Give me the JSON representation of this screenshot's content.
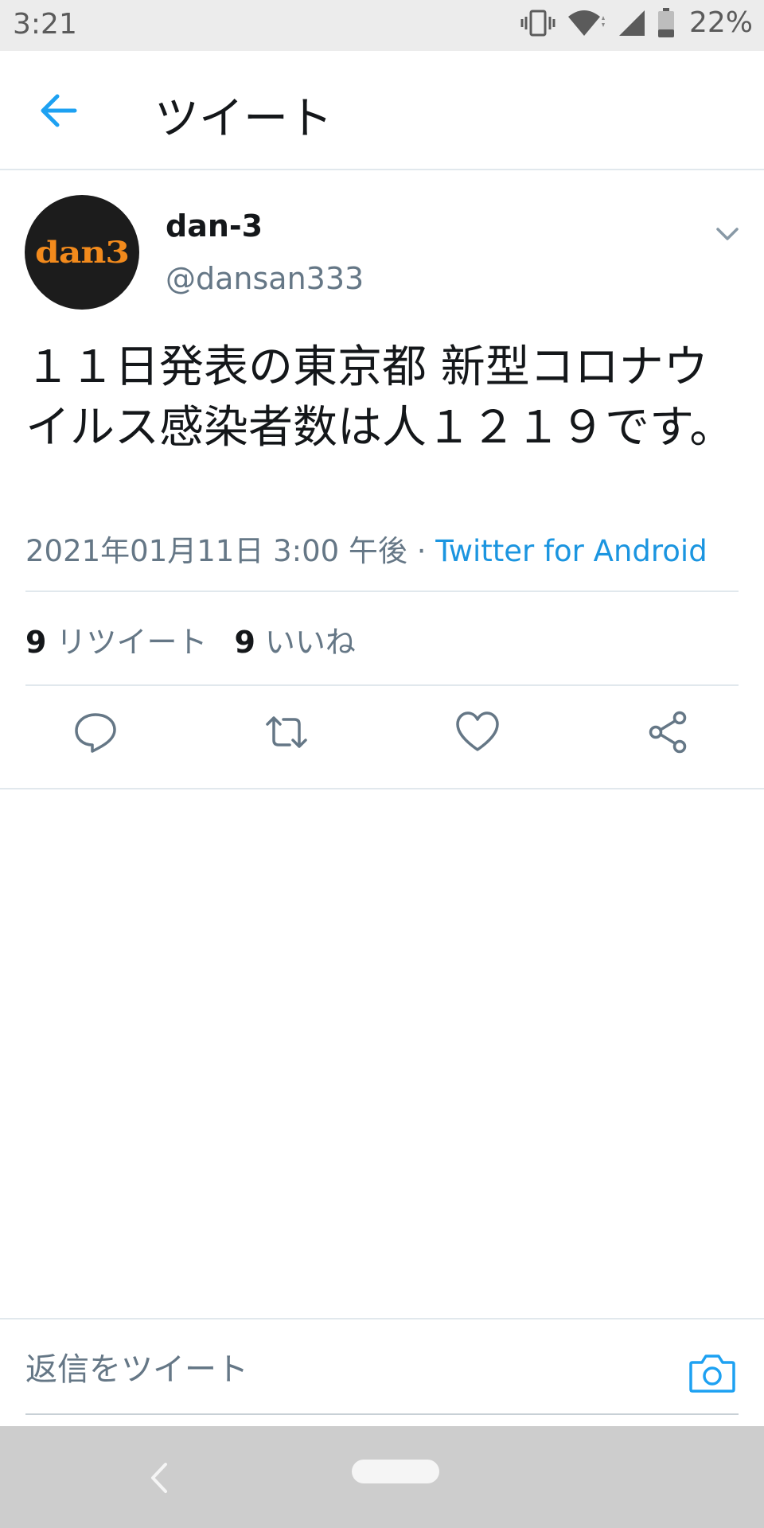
{
  "status_bar": {
    "time": "3:21",
    "battery_percent": "22%"
  },
  "header": {
    "title": "ツイート"
  },
  "tweet": {
    "display_name": "dan-3",
    "handle": "@dansan333",
    "avatar_text": "dan3",
    "text": "１１日発表の東京都 新型コロナウイルス感染者数は人１２１９です。",
    "timestamp": "2021年01月11日 3:00 午後",
    "separator": "·",
    "source": "Twitter for Android",
    "retweet_count": "9",
    "retweet_label": "リツイート",
    "like_count": "9",
    "like_label": "いいね"
  },
  "reply": {
    "placeholder": "返信をツイート"
  },
  "colors": {
    "accent": "#1da1f2",
    "source_link": "#1b95e0",
    "secondary_text": "#657786",
    "divider": "#e1e8ed"
  }
}
